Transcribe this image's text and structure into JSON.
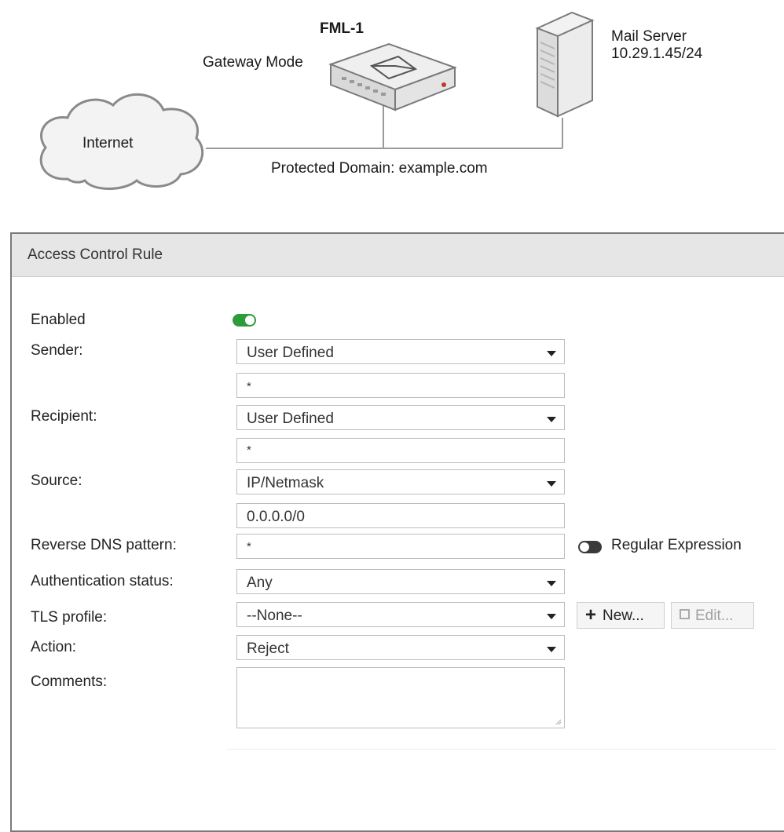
{
  "diagram": {
    "device_name": "FML-1",
    "device_mode": "Gateway Mode",
    "cloud_label": "Internet",
    "server_label_line1": "Mail Server",
    "server_label_line2": "10.29.1.45/24",
    "domain_label": "Protected Domain: example.com"
  },
  "panel": {
    "title": "Access Control Rule",
    "enabled_label": "Enabled",
    "enabled_state": "on",
    "sender_label": "Sender:",
    "sender_type": "User Defined",
    "sender_value": "*",
    "recipient_label": "Recipient:",
    "recipient_type": "User Defined",
    "recipient_value": "*",
    "source_label": "Source:",
    "source_type": "IP/Netmask",
    "source_value": "0.0.0.0/0",
    "rdns_label": "Reverse DNS pattern:",
    "rdns_value": "*",
    "regex_label": "Regular Expression",
    "regex_state": "off",
    "auth_label": "Authentication status:",
    "auth_value": "Any",
    "tls_label": "TLS profile:",
    "tls_value": "--None--",
    "new_button": "New...",
    "edit_button": "Edit...",
    "action_label": "Action:",
    "action_value": "Reject",
    "comments_label": "Comments:",
    "comments_value": ""
  },
  "colors": {
    "toggle_on": "#2e9b3a",
    "toggle_off": "#3a3a3a",
    "header_bg": "#e6e6e6"
  }
}
